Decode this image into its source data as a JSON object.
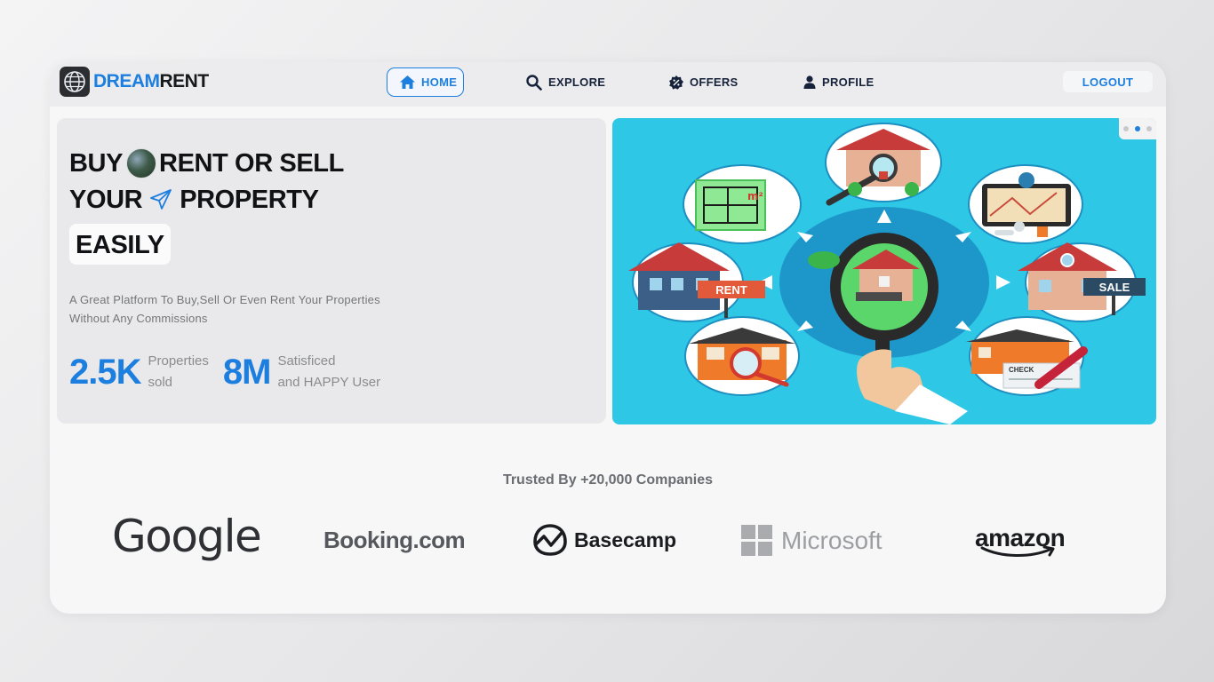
{
  "brand": {
    "name_part1": "DREAM",
    "name_part2": "RENT",
    "logo_icon": "globe-icon"
  },
  "nav": {
    "items": [
      {
        "label": "HOME",
        "icon": "home-icon",
        "active": true
      },
      {
        "label": "EXPLORE",
        "icon": "search-icon",
        "active": false
      },
      {
        "label": "OFFERS",
        "icon": "badge-percent-icon",
        "active": false
      },
      {
        "label": "PROFILE",
        "icon": "user-icon",
        "active": false
      }
    ],
    "logout_label": "LOGOUT"
  },
  "hero": {
    "line1_a": "BUY",
    "line1_b": "RENT OR SELL",
    "line2_a": "YOUR",
    "line2_b": "PROPERTY",
    "line3": "EASILY",
    "subtext": "A Great Platform To Buy,Sell Or Even Rent Your Properties Without Any Commissions",
    "stats": [
      {
        "value": "2.5K",
        "label_line1": "Properties",
        "label_line2": "sold"
      },
      {
        "value": "8M",
        "label_line1": "Satisficed",
        "label_line2": "and HAPPY User"
      }
    ]
  },
  "illustration": {
    "rent_label": "RENT",
    "sale_label": "SALE",
    "check_label": "CHECK",
    "area_label": "m²",
    "carousel_slide": 2,
    "carousel_total": 3
  },
  "trusted": {
    "title": "Trusted By +20,000 Companies",
    "logos": [
      "Google",
      "Booking.com",
      "Basecamp",
      "Microsoft",
      "amazon"
    ]
  },
  "colors": {
    "accent": "#1c7fe0",
    "illustration_bg": "#2ec7e6",
    "text_dark": "#111215"
  }
}
